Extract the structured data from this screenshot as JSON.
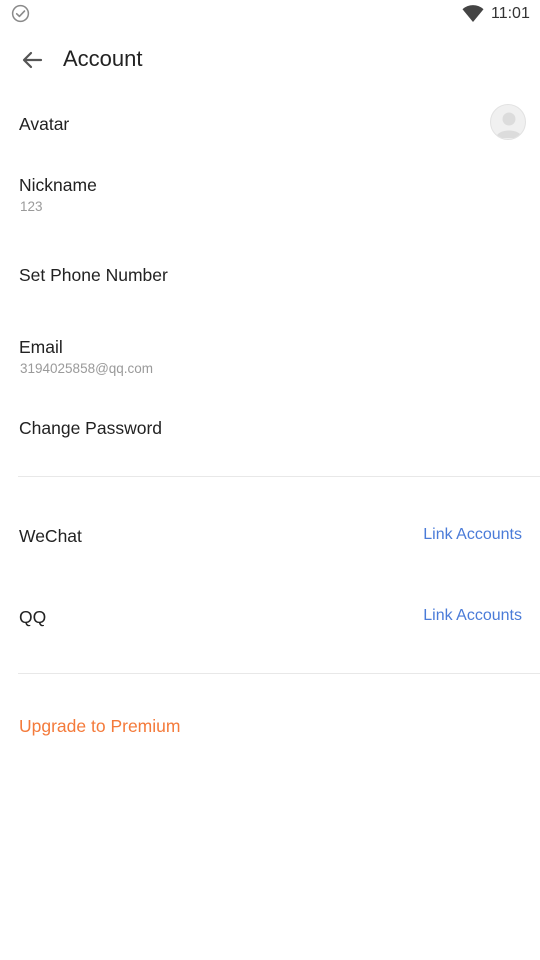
{
  "status_bar": {
    "time": "11:01",
    "left_icon": "check-circle-icon",
    "signal_icon": "wifi-icon"
  },
  "header": {
    "back_icon": "arrow-back-icon",
    "title": "Account"
  },
  "profile": {
    "avatar_label": "Avatar",
    "nickname_label": "Nickname",
    "nickname_value": "123",
    "phone_label": "Set Phone Number",
    "email_label": "Email",
    "email_value": "3194025858@qq.com",
    "password_label": "Change Password"
  },
  "linked_accounts": {
    "wechat_label": "WeChat",
    "wechat_action": "Link Accounts",
    "qq_label": "QQ",
    "qq_action": "Link Accounts"
  },
  "premium": {
    "label": "Upgrade to Premium"
  },
  "colors": {
    "link": "#4a7bd8",
    "premium": "#f47a3a",
    "secondary_text": "#9a9a9a",
    "divider": "#e8e8e8"
  }
}
